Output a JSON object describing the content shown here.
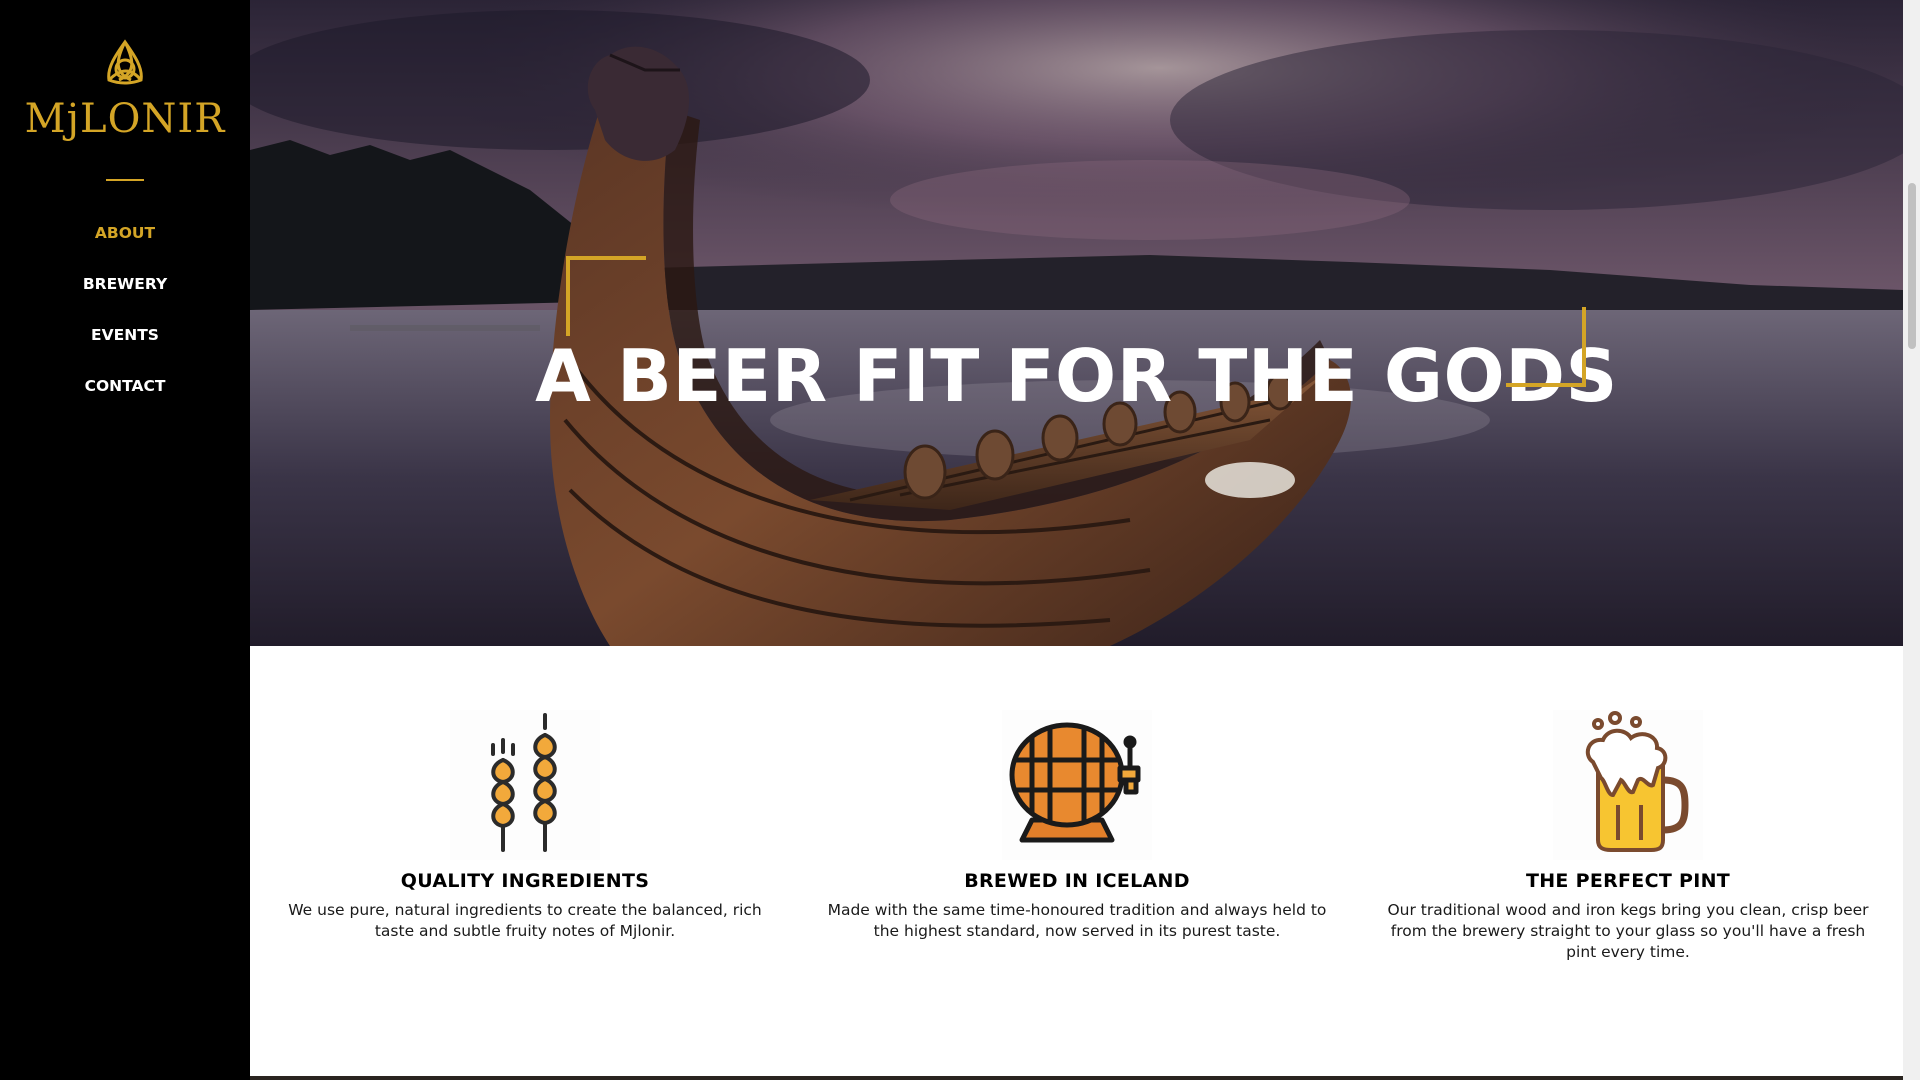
{
  "brand": {
    "name": "MjLONIR",
    "logo_icon": "triquetra-knot-icon",
    "accent_color": "#d4a526"
  },
  "nav": {
    "items": [
      {
        "label": "ABOUT",
        "active": true
      },
      {
        "label": "BREWERY",
        "active": false
      },
      {
        "label": "EVENTS",
        "active": false
      },
      {
        "label": "CONTACT",
        "active": false
      }
    ]
  },
  "hero": {
    "title": "A BEER FIT FOR THE GODS",
    "image": "viking-longship-on-lake"
  },
  "features": [
    {
      "icon": "wheat-icon",
      "title": "QUALITY INGREDIENTS",
      "text": "We use pure, natural ingredients to create the balanced, rich taste and subtle fruity notes of Mjlonir."
    },
    {
      "icon": "beer-barrel-icon",
      "title": "BREWED IN ICELAND",
      "text": "Made with the same time-honoured tradition and always held to the highest standard, now served in its purest taste."
    },
    {
      "icon": "beer-mug-icon",
      "title": "THE PERFECT PINT",
      "text": "Our traditional wood and iron kegs bring you clean, crisp beer from the brewery straight to your glass so you'll have a fresh pint every time."
    }
  ]
}
